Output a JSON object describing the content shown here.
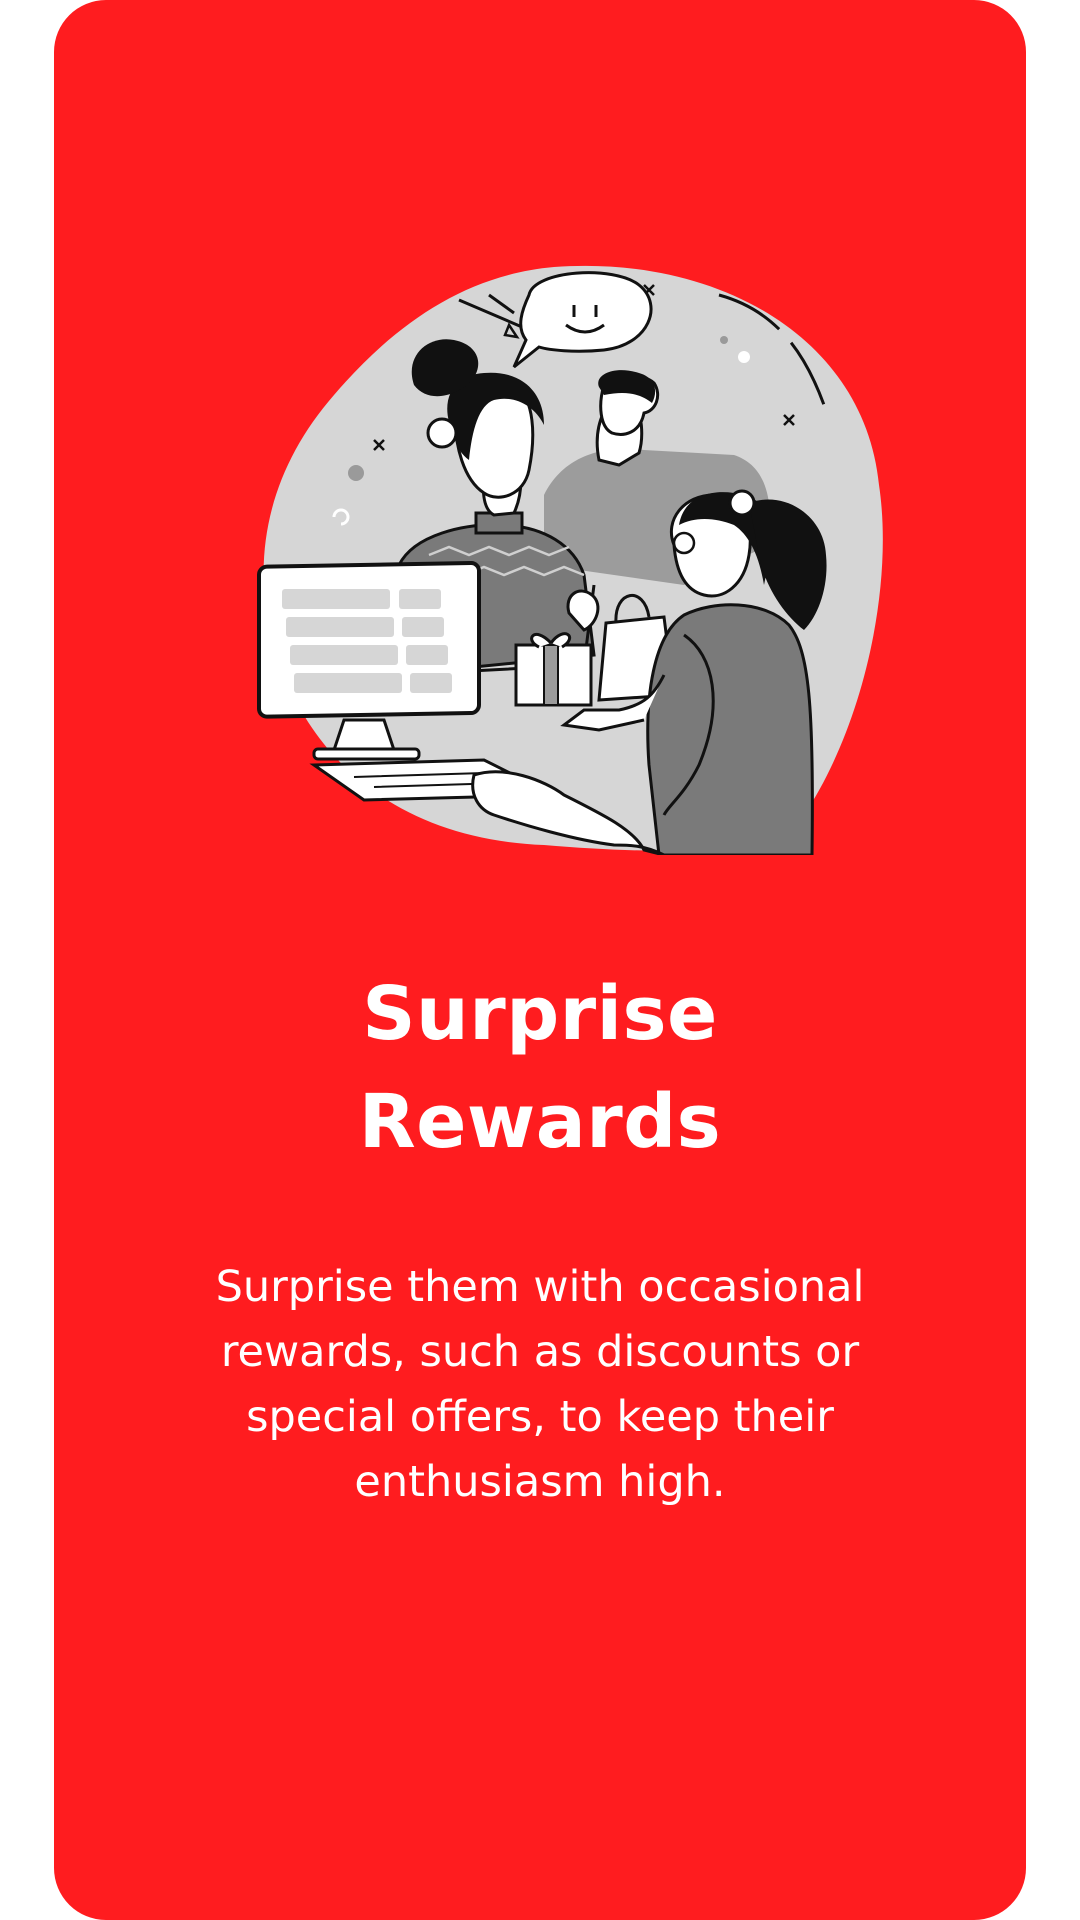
{
  "card": {
    "background_color": "#ff1c1f",
    "illustration_icon": "customer-service-gift-illustration",
    "title_line1": "Surprise",
    "title_line2": "Rewards",
    "description": "Surprise them with occasional rewards, such as discounts or special offers, to keep their enthusiasm high."
  }
}
